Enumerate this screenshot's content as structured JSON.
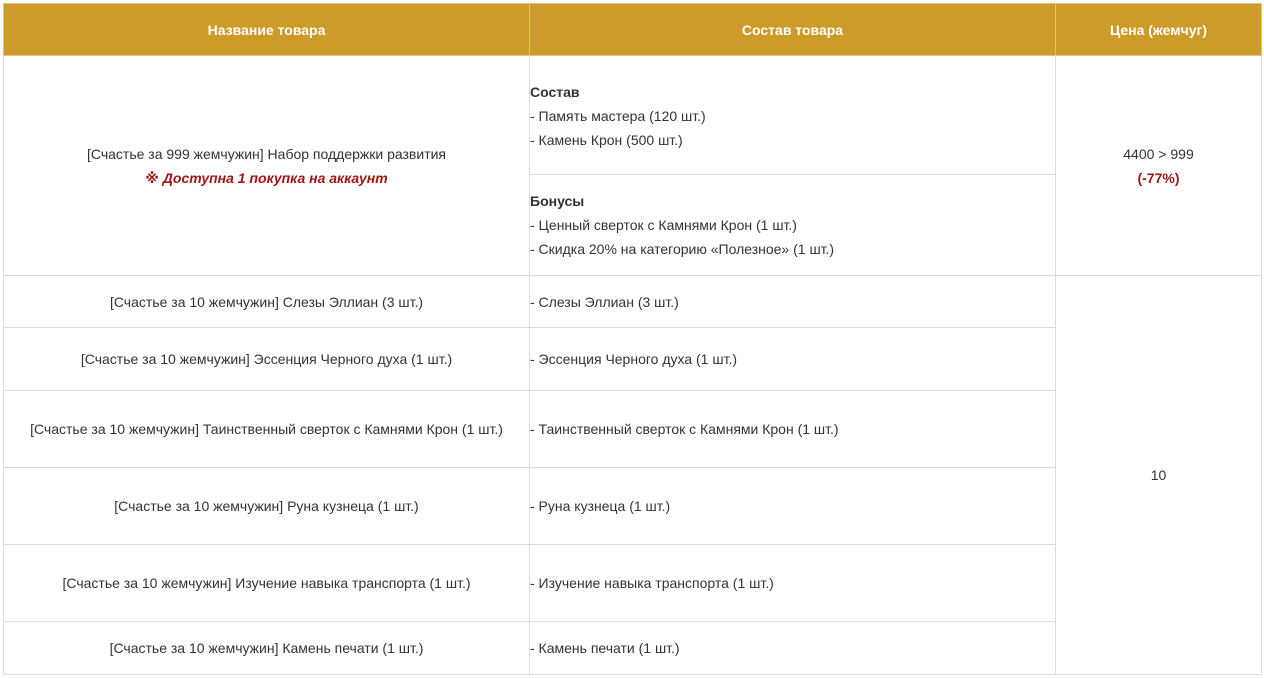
{
  "headers": {
    "name": "Название товара",
    "composition": "Состав товара",
    "price": "Цена (жемчуг)"
  },
  "bundle": {
    "name": "[Счастье за 999 жемчужин] Набор поддержки развития",
    "note": "※ Доступна 1 покупка на аккаунт",
    "contents_title": "Состав",
    "contents": [
      "- Память мастера (120 шт.)",
      "- Камень Крон (500 шт.)"
    ],
    "bonus_title": "Бонусы",
    "bonuses": [
      "- Ценный сверток с Камнями Крон (1 шт.)",
      "- Скидка 20% на категорию «Полезное» (1 шт.)"
    ],
    "price": "4400 > 999",
    "discount": "(-77%)"
  },
  "items_price": "10",
  "items": [
    {
      "name": "[Счастье за 10 жемчужин] Слезы Эллиан (3 шт.)",
      "composition": "- Слезы Эллиан (3 шт.)"
    },
    {
      "name": "[Счастье за 10 жемчужин] Эссенция Черного духа (1 шт.)",
      "composition": "- Эссенция Черного духа (1 шт.)"
    },
    {
      "name": "[Счастье за 10 жемчужин] Таинственный сверток с Камнями Крон (1 шт.)",
      "composition": "- Таинственный сверток с Камнями Крон (1 шт.)"
    },
    {
      "name": "[Счастье за 10 жемчужин] Руна кузнеца (1 шт.)",
      "composition": "- Руна кузнеца (1 шт.)"
    },
    {
      "name": "[Счастье за 10 жемчужин] Изучение навыка транспорта (1 шт.)",
      "composition": "- Изучение навыка транспорта (1 шт.)"
    },
    {
      "name": "[Счастье за 10 жемчужин] Камень печати (1 шт.)",
      "composition": "- Камень печати (1 шт.)"
    }
  ]
}
